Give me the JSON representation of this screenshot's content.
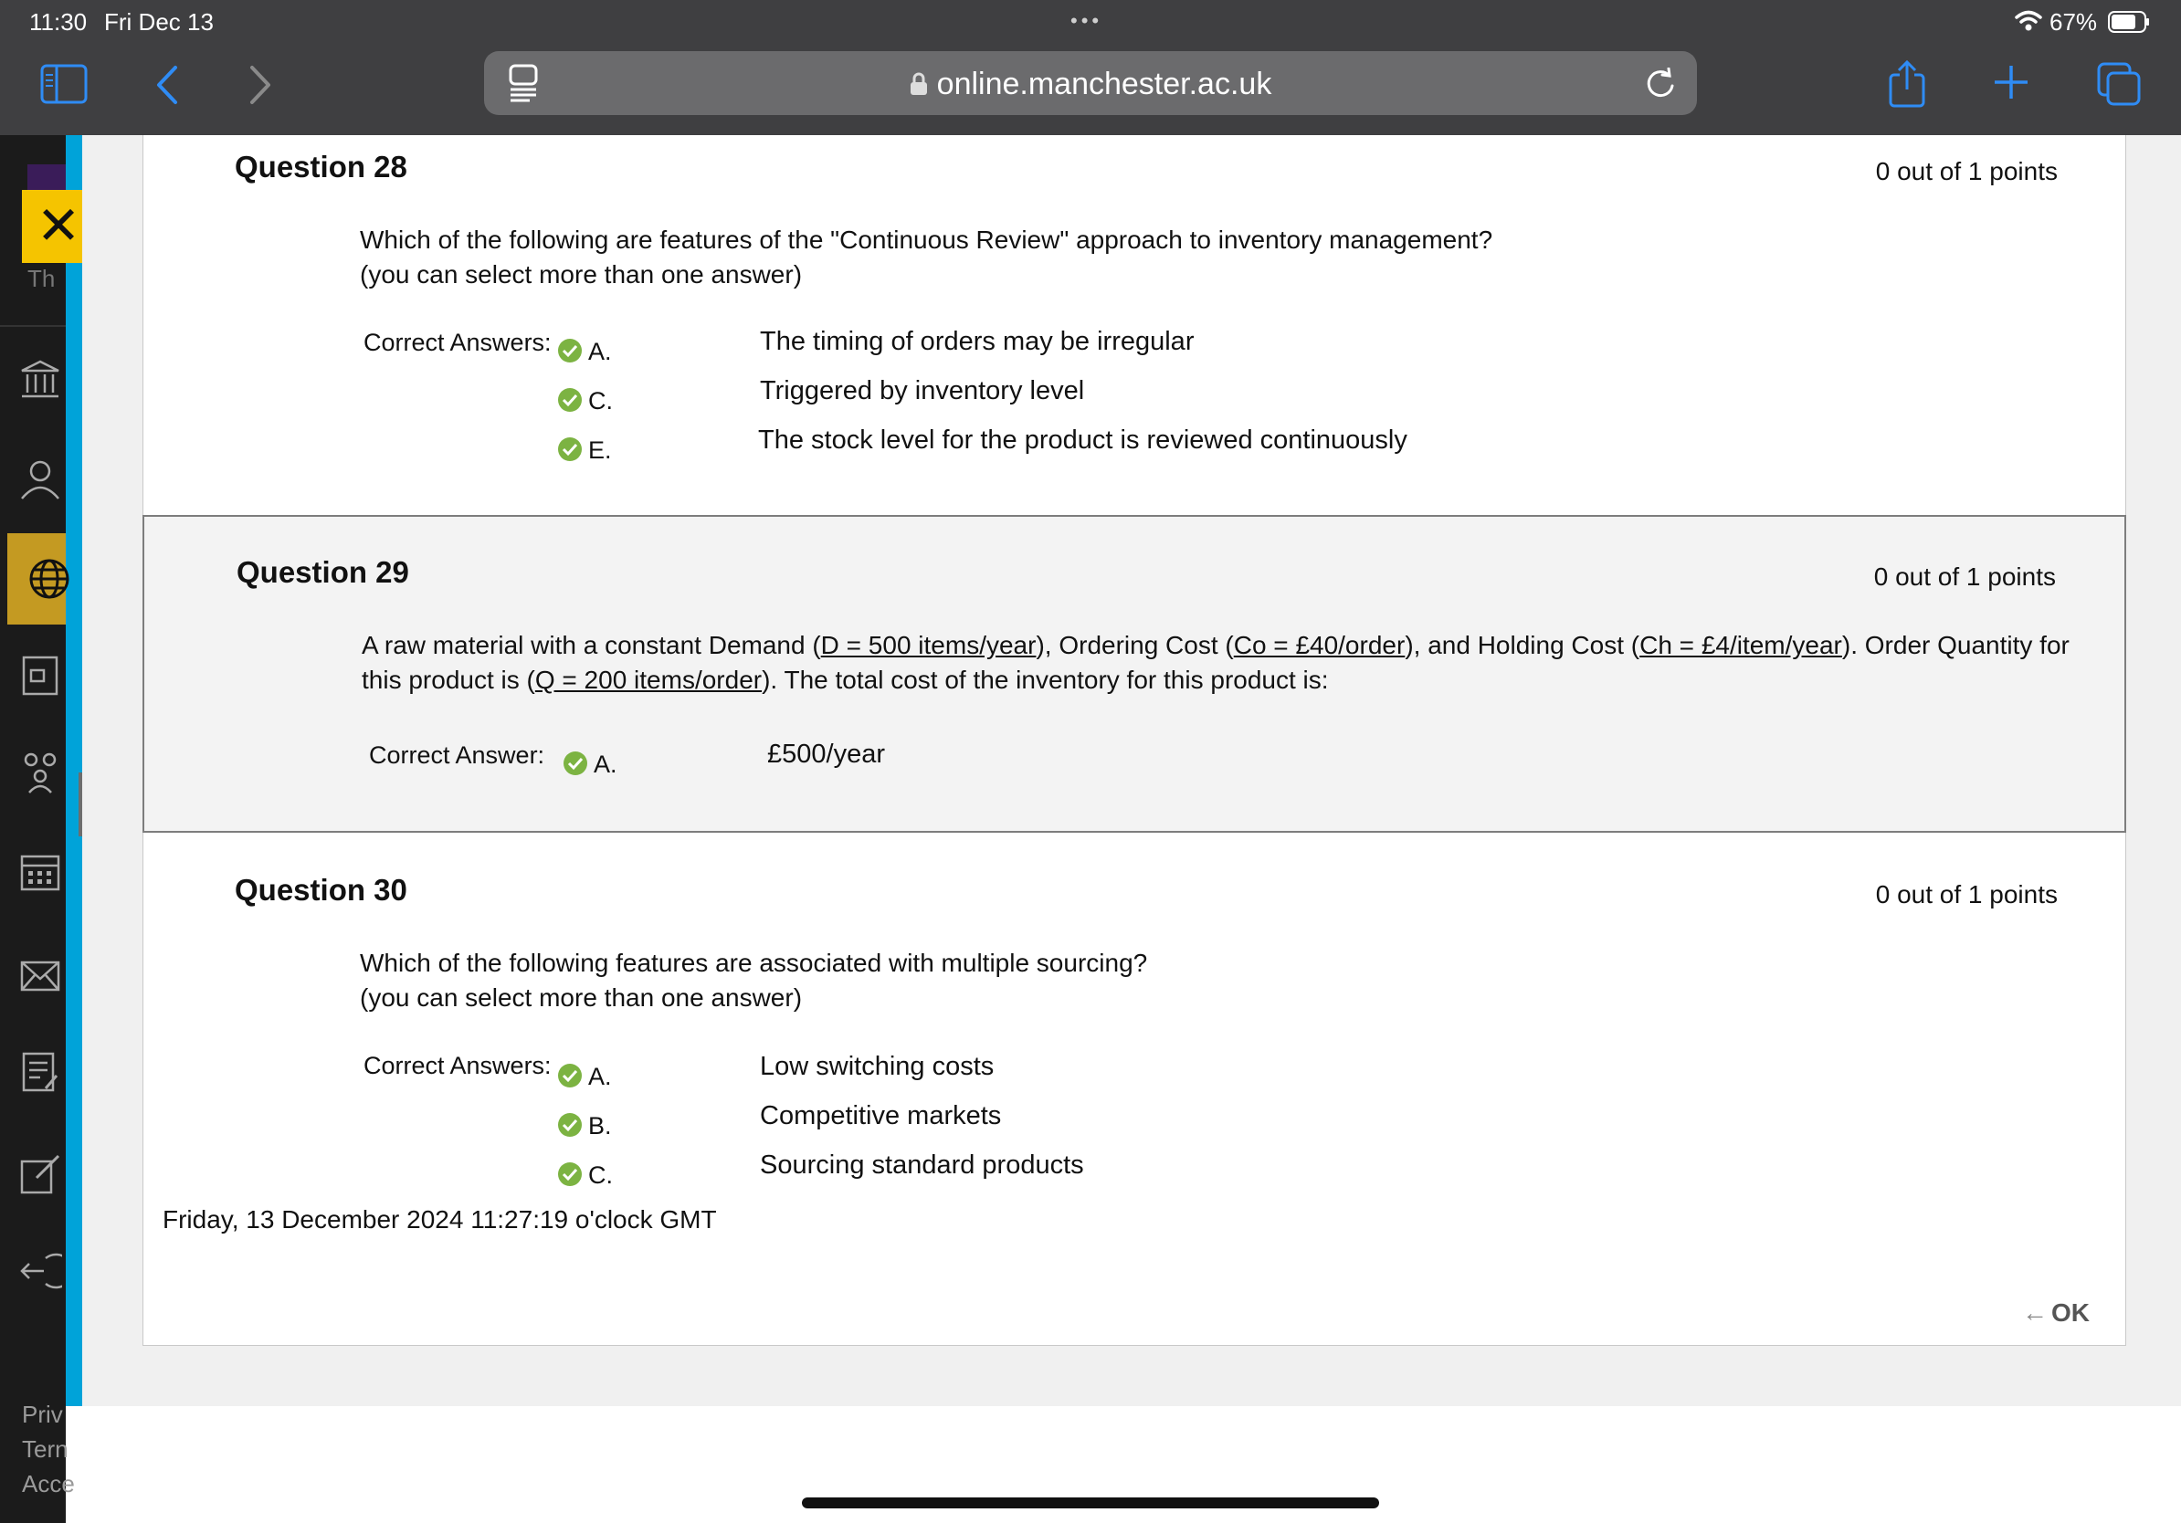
{
  "status_bar": {
    "time": "11:30",
    "date": "Fri Dec 13",
    "battery": "67%"
  },
  "browser": {
    "url": "online.manchester.ac.uk"
  },
  "questions": [
    {
      "title": "Question 28",
      "points": "0 out of 1 points",
      "text_line1": "Which of the following are features of the \"Continuous Review\" approach to inventory management?",
      "text_line2": "(you can select more than one answer)",
      "answers_label": "Correct Answers:",
      "answers": [
        {
          "letter": "A.",
          "text": "The timing of orders may be irregular"
        },
        {
          "letter": "C.",
          "text": "Triggered by inventory level"
        },
        {
          "letter": "E.",
          "text": "The stock level for the product is reviewed continuously"
        }
      ]
    },
    {
      "title": "Question 29",
      "points": "0 out of 1 points",
      "parts": {
        "p1": "A raw material with a constant Demand (",
        "u1": "D = 500 items/year",
        "p2": "), Ordering Cost (",
        "u2": "Co = £40/order",
        "p3": "), and Holding Cost (",
        "u3": "Ch = £4/item/year",
        "p4": "). Order Quantity for this product is (",
        "u4": "Q = 200 items/order",
        "p5": "). The total cost of the inventory for this product is:"
      },
      "answers_label": "Correct Answer:",
      "answers": [
        {
          "letter": "A.",
          "text": "£500/year"
        }
      ]
    },
    {
      "title": "Question 30",
      "points": "0 out of 1 points",
      "text_line1": "Which of the following features are associated with multiple sourcing?",
      "text_line2": "(you can select more than one answer)",
      "answers_label": "Correct Answers:",
      "answers": [
        {
          "letter": "A.",
          "text": "Low switching costs"
        },
        {
          "letter": "B.",
          "text": "Competitive markets"
        },
        {
          "letter": "C.",
          "text": "Sourcing standard products"
        }
      ]
    }
  ],
  "timestamp": "Friday, 13 December 2024 11:27:19 o'clock GMT",
  "ok_label": "OK",
  "left_nav": {
    "footer_links": [
      "Priv",
      "Tern",
      "Acce"
    ],
    "partial_text": "Th"
  },
  "colors": {
    "accent": "#00a3d9",
    "close": "#f5c400",
    "check": "#7cb342"
  }
}
